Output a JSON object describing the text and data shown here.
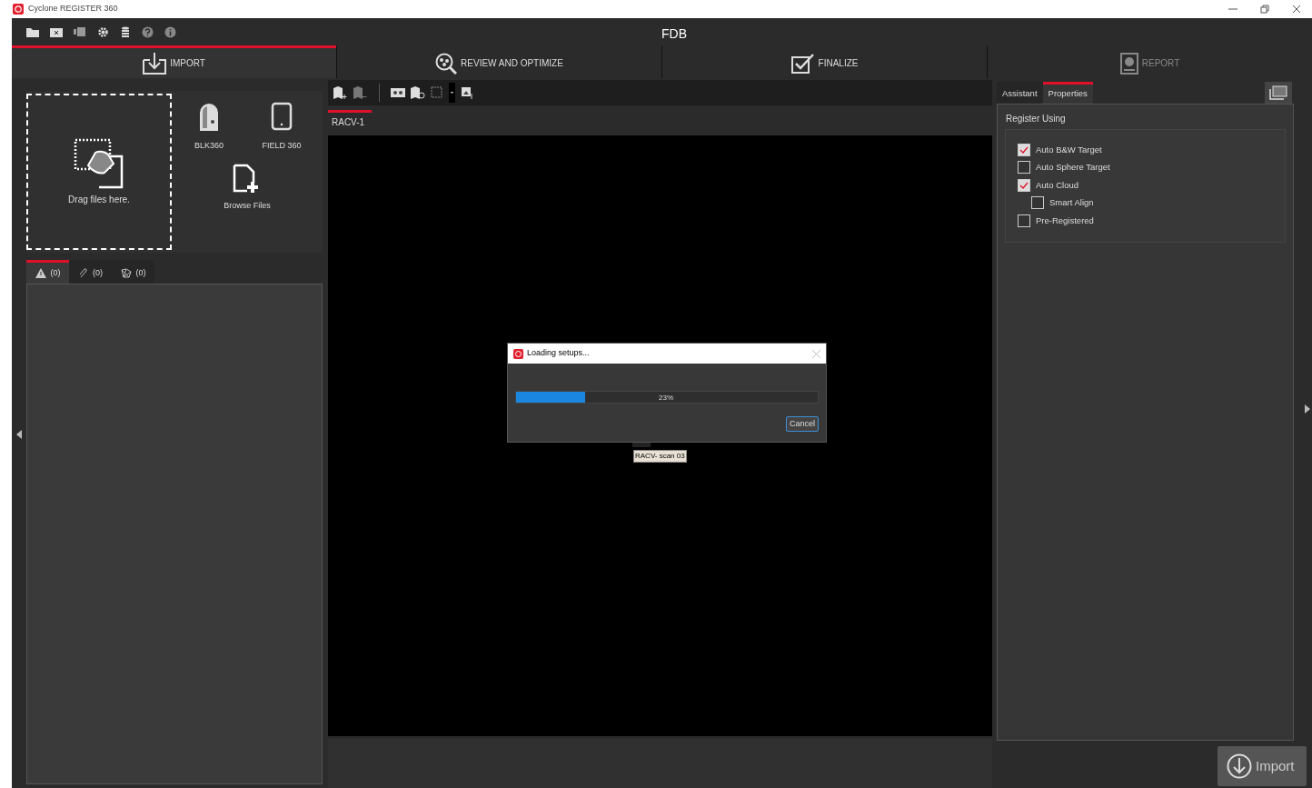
{
  "window": {
    "title": "Cyclone REGISTER 360"
  },
  "project_title": "FDB",
  "steps": [
    {
      "label": "IMPORT",
      "selected": true,
      "disabled": false
    },
    {
      "label": "REVIEW AND OPTIMIZE",
      "selected": false,
      "disabled": false
    },
    {
      "label": "FINALIZE",
      "selected": false,
      "disabled": false
    },
    {
      "label": "REPORT",
      "selected": false,
      "disabled": true
    }
  ],
  "import_panel": {
    "drop_zone": "Drag files here.",
    "devices": [
      "BLK360",
      "FIELD 360"
    ],
    "browse": "Browse Files"
  },
  "list_tabs": [
    {
      "label": "(0)",
      "selected": true
    },
    {
      "label": "(0)",
      "selected": false
    },
    {
      "label": "(0)",
      "selected": false
    }
  ],
  "viewer": {
    "tabs": [
      {
        "label": "RACV-1",
        "selected": true
      }
    ],
    "scan_label": "RACV- scan 03"
  },
  "dialog": {
    "title": "Loading setups...",
    "progress": {
      "level": 0.23,
      "reading": "23%"
    },
    "buttons": [
      "Cancel"
    ]
  },
  "properties": {
    "tabs": [
      {
        "label": "Assistant",
        "selected": false
      },
      {
        "label": "Properties",
        "selected": true
      }
    ],
    "group_title": "Register Using",
    "options": [
      {
        "label": "Auto B&W Target",
        "checked": true
      },
      {
        "label": "Auto Sphere Target",
        "checked": false
      },
      {
        "label": "Auto Cloud",
        "checked": true,
        "children": [
          {
            "label": "Smart Align",
            "checked": false
          }
        ]
      },
      {
        "label": "Pre-Registered",
        "checked": false
      }
    ]
  },
  "import_button": "Import"
}
